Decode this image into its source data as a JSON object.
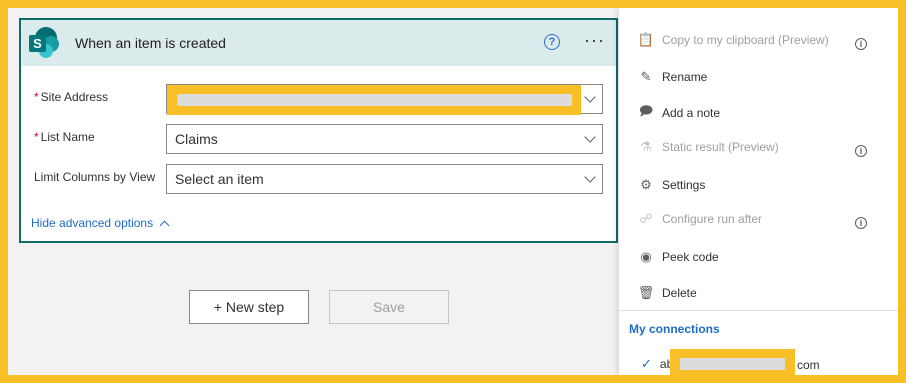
{
  "trigger": {
    "title": "When an item is created",
    "help_icon": "?",
    "more_icon": "···",
    "fields": {
      "site_address_label": "Site Address",
      "list_name_label": "List Name",
      "list_name_value": "Claims",
      "limit_columns_label": "Limit Columns by View",
      "limit_columns_placeholder": "Select an item"
    },
    "required_marker": "*",
    "advanced_link": "Hide advanced options"
  },
  "actions": {
    "new_step": "+ New step",
    "save": "Save"
  },
  "menu": {
    "items": [
      {
        "label": "Copy to my clipboard (Preview)",
        "icon": "clipboard-icon",
        "disabled": true,
        "info": true
      },
      {
        "label": "Rename",
        "icon": "pencil-icon",
        "disabled": false,
        "info": false
      },
      {
        "label": "Add a note",
        "icon": "note-icon",
        "disabled": false,
        "info": false
      },
      {
        "label": "Static result (Preview)",
        "icon": "flask-icon",
        "disabled": true,
        "info": true
      },
      {
        "label": "Settings",
        "icon": "gear-icon",
        "disabled": false,
        "info": false
      },
      {
        "label": "Configure run after",
        "icon": "run-after-icon",
        "disabled": true,
        "info": true
      },
      {
        "label": "Peek code",
        "icon": "eye-icon",
        "disabled": false,
        "info": false
      },
      {
        "label": "Delete",
        "icon": "trash-icon",
        "disabled": false,
        "info": false
      }
    ],
    "connections_heading": "My connections",
    "connection_prefix": "ab",
    "connection_suffix": "com"
  },
  "colors": {
    "accent": "#0f6a6a",
    "link": "#1f6cc5",
    "highlight": "#f9bf26",
    "required": "#c50f1f"
  }
}
